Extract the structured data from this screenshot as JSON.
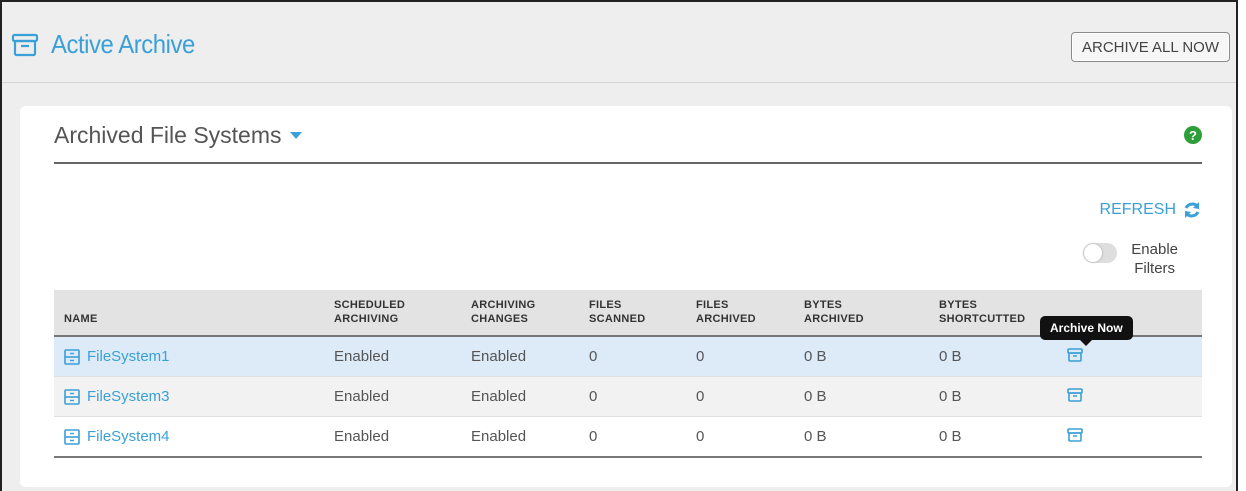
{
  "header": {
    "title": "Active Archive",
    "archive_all_label": "ARCHIVE ALL NOW",
    "icon": "archive-box-icon"
  },
  "card": {
    "title": "Archived File Systems",
    "help_label": "?",
    "refresh_label": "REFRESH",
    "filters_label_line1": "Enable",
    "filters_label_line2": "Filters",
    "filters_enabled": false
  },
  "table": {
    "columns": [
      {
        "line1": "NAME",
        "line2": ""
      },
      {
        "line1": "SCHEDULED",
        "line2": "ARCHIVING"
      },
      {
        "line1": "ARCHIVING",
        "line2": "CHANGES"
      },
      {
        "line1": "FILES",
        "line2": "SCANNED"
      },
      {
        "line1": "FILES",
        "line2": "ARCHIVED"
      },
      {
        "line1": "BYTES",
        "line2": "ARCHIVED"
      },
      {
        "line1": "BYTES",
        "line2": "SHORTCUTTED"
      },
      {
        "line1": "",
        "line2": ""
      }
    ],
    "rows": [
      {
        "name": "FileSystem1",
        "scheduled": "Enabled",
        "changes": "Enabled",
        "scanned": "0",
        "archived": "0",
        "bytes_archived": "0 B",
        "bytes_shortcutted": "0 B"
      },
      {
        "name": "FileSystem3",
        "scheduled": "Enabled",
        "changes": "Enabled",
        "scanned": "0",
        "archived": "0",
        "bytes_archived": "0 B",
        "bytes_shortcutted": "0 B"
      },
      {
        "name": "FileSystem4",
        "scheduled": "Enabled",
        "changes": "Enabled",
        "scanned": "0",
        "archived": "0",
        "bytes_archived": "0 B",
        "bytes_shortcutted": "0 B"
      }
    ]
  },
  "tooltip": "Archive Now",
  "colors": {
    "accent": "#3aa0d8",
    "help": "#2e9e3b",
    "selected_row": "#dcebf7"
  }
}
